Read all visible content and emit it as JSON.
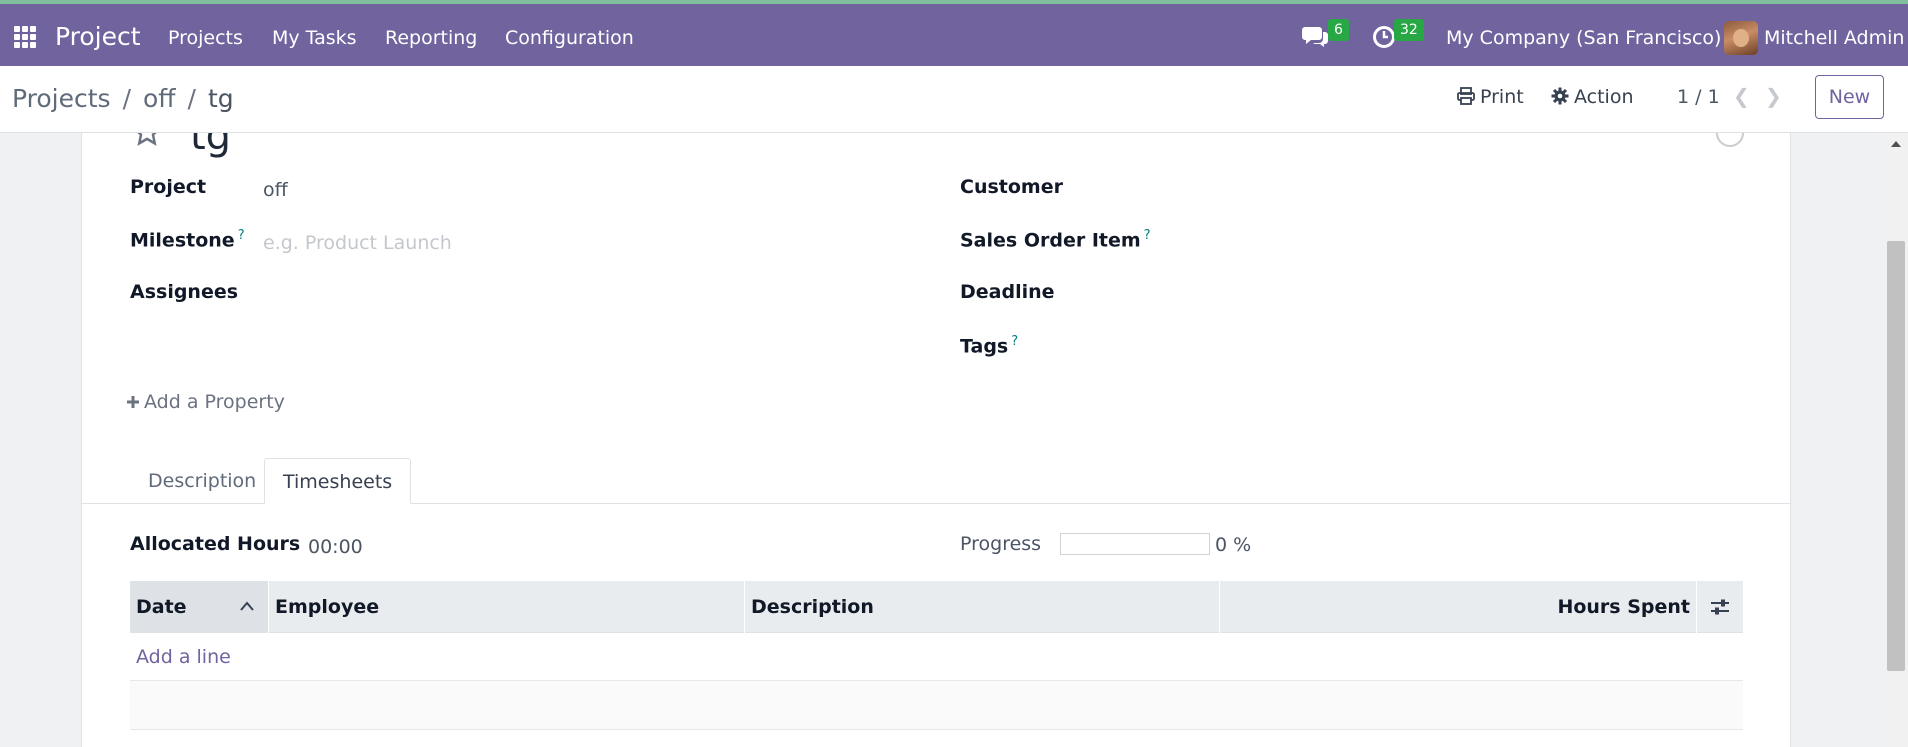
{
  "navbar": {
    "brand": "Project",
    "menu": [
      "Projects",
      "My Tasks",
      "Reporting",
      "Configuration"
    ],
    "messages_count": "6",
    "activities_count": "32",
    "company": "My Company (San Francisco)",
    "user": "Mitchell Admin",
    "color": "#71639e"
  },
  "breadcrumb": {
    "items": [
      "Projects",
      "off",
      "tg"
    ],
    "separator": "/"
  },
  "control_panel": {
    "print_label": "Print",
    "action_label": "Action",
    "pager": "1 / 1",
    "new_label": "New"
  },
  "task": {
    "title": "tg",
    "fields_left": {
      "project_label": "Project",
      "project_value": "off",
      "milestone_label": "Milestone",
      "milestone_help": "?",
      "milestone_placeholder": "e.g. Product Launch",
      "assignees_label": "Assignees"
    },
    "fields_right": {
      "customer_label": "Customer",
      "sale_line_label": "Sales Order Item",
      "sale_line_help": "?",
      "deadline_label": "Deadline",
      "tags_label": "Tags",
      "tags_help": "?"
    },
    "add_property": "Add a Property"
  },
  "tabs": [
    {
      "label": "Description",
      "active": false
    },
    {
      "label": "Timesheets",
      "active": true
    }
  ],
  "timesheets": {
    "allocated_label": "Allocated Hours",
    "allocated_value": "00:00",
    "progress_label": "Progress",
    "progress_text": "0 %",
    "progress_value": 0,
    "columns": [
      "Date",
      "Employee",
      "Description",
      "Hours Spent"
    ],
    "add_line": "Add a line"
  }
}
